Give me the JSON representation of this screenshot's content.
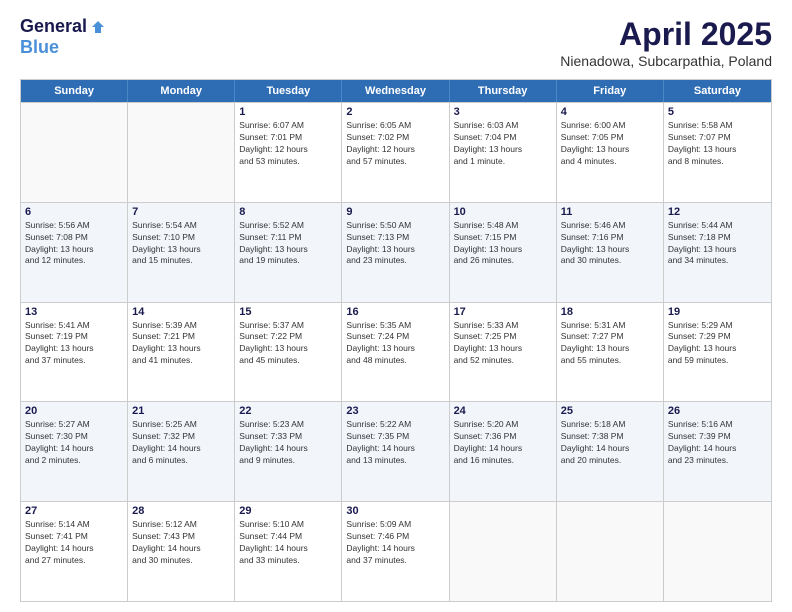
{
  "header": {
    "logo_general": "General",
    "logo_blue": "Blue",
    "title": "April 2025",
    "location": "Nienadowa, Subcarpathia, Poland"
  },
  "days_of_week": [
    "Sunday",
    "Monday",
    "Tuesday",
    "Wednesday",
    "Thursday",
    "Friday",
    "Saturday"
  ],
  "rows": [
    [
      {
        "day": "",
        "info": ""
      },
      {
        "day": "",
        "info": ""
      },
      {
        "day": "1",
        "info": "Sunrise: 6:07 AM\nSunset: 7:01 PM\nDaylight: 12 hours\nand 53 minutes."
      },
      {
        "day": "2",
        "info": "Sunrise: 6:05 AM\nSunset: 7:02 PM\nDaylight: 12 hours\nand 57 minutes."
      },
      {
        "day": "3",
        "info": "Sunrise: 6:03 AM\nSunset: 7:04 PM\nDaylight: 13 hours\nand 1 minute."
      },
      {
        "day": "4",
        "info": "Sunrise: 6:00 AM\nSunset: 7:05 PM\nDaylight: 13 hours\nand 4 minutes."
      },
      {
        "day": "5",
        "info": "Sunrise: 5:58 AM\nSunset: 7:07 PM\nDaylight: 13 hours\nand 8 minutes."
      }
    ],
    [
      {
        "day": "6",
        "info": "Sunrise: 5:56 AM\nSunset: 7:08 PM\nDaylight: 13 hours\nand 12 minutes."
      },
      {
        "day": "7",
        "info": "Sunrise: 5:54 AM\nSunset: 7:10 PM\nDaylight: 13 hours\nand 15 minutes."
      },
      {
        "day": "8",
        "info": "Sunrise: 5:52 AM\nSunset: 7:11 PM\nDaylight: 13 hours\nand 19 minutes."
      },
      {
        "day": "9",
        "info": "Sunrise: 5:50 AM\nSunset: 7:13 PM\nDaylight: 13 hours\nand 23 minutes."
      },
      {
        "day": "10",
        "info": "Sunrise: 5:48 AM\nSunset: 7:15 PM\nDaylight: 13 hours\nand 26 minutes."
      },
      {
        "day": "11",
        "info": "Sunrise: 5:46 AM\nSunset: 7:16 PM\nDaylight: 13 hours\nand 30 minutes."
      },
      {
        "day": "12",
        "info": "Sunrise: 5:44 AM\nSunset: 7:18 PM\nDaylight: 13 hours\nand 34 minutes."
      }
    ],
    [
      {
        "day": "13",
        "info": "Sunrise: 5:41 AM\nSunset: 7:19 PM\nDaylight: 13 hours\nand 37 minutes."
      },
      {
        "day": "14",
        "info": "Sunrise: 5:39 AM\nSunset: 7:21 PM\nDaylight: 13 hours\nand 41 minutes."
      },
      {
        "day": "15",
        "info": "Sunrise: 5:37 AM\nSunset: 7:22 PM\nDaylight: 13 hours\nand 45 minutes."
      },
      {
        "day": "16",
        "info": "Sunrise: 5:35 AM\nSunset: 7:24 PM\nDaylight: 13 hours\nand 48 minutes."
      },
      {
        "day": "17",
        "info": "Sunrise: 5:33 AM\nSunset: 7:25 PM\nDaylight: 13 hours\nand 52 minutes."
      },
      {
        "day": "18",
        "info": "Sunrise: 5:31 AM\nSunset: 7:27 PM\nDaylight: 13 hours\nand 55 minutes."
      },
      {
        "day": "19",
        "info": "Sunrise: 5:29 AM\nSunset: 7:29 PM\nDaylight: 13 hours\nand 59 minutes."
      }
    ],
    [
      {
        "day": "20",
        "info": "Sunrise: 5:27 AM\nSunset: 7:30 PM\nDaylight: 14 hours\nand 2 minutes."
      },
      {
        "day": "21",
        "info": "Sunrise: 5:25 AM\nSunset: 7:32 PM\nDaylight: 14 hours\nand 6 minutes."
      },
      {
        "day": "22",
        "info": "Sunrise: 5:23 AM\nSunset: 7:33 PM\nDaylight: 14 hours\nand 9 minutes."
      },
      {
        "day": "23",
        "info": "Sunrise: 5:22 AM\nSunset: 7:35 PM\nDaylight: 14 hours\nand 13 minutes."
      },
      {
        "day": "24",
        "info": "Sunrise: 5:20 AM\nSunset: 7:36 PM\nDaylight: 14 hours\nand 16 minutes."
      },
      {
        "day": "25",
        "info": "Sunrise: 5:18 AM\nSunset: 7:38 PM\nDaylight: 14 hours\nand 20 minutes."
      },
      {
        "day": "26",
        "info": "Sunrise: 5:16 AM\nSunset: 7:39 PM\nDaylight: 14 hours\nand 23 minutes."
      }
    ],
    [
      {
        "day": "27",
        "info": "Sunrise: 5:14 AM\nSunset: 7:41 PM\nDaylight: 14 hours\nand 27 minutes."
      },
      {
        "day": "28",
        "info": "Sunrise: 5:12 AM\nSunset: 7:43 PM\nDaylight: 14 hours\nand 30 minutes."
      },
      {
        "day": "29",
        "info": "Sunrise: 5:10 AM\nSunset: 7:44 PM\nDaylight: 14 hours\nand 33 minutes."
      },
      {
        "day": "30",
        "info": "Sunrise: 5:09 AM\nSunset: 7:46 PM\nDaylight: 14 hours\nand 37 minutes."
      },
      {
        "day": "",
        "info": ""
      },
      {
        "day": "",
        "info": ""
      },
      {
        "day": "",
        "info": ""
      }
    ]
  ]
}
